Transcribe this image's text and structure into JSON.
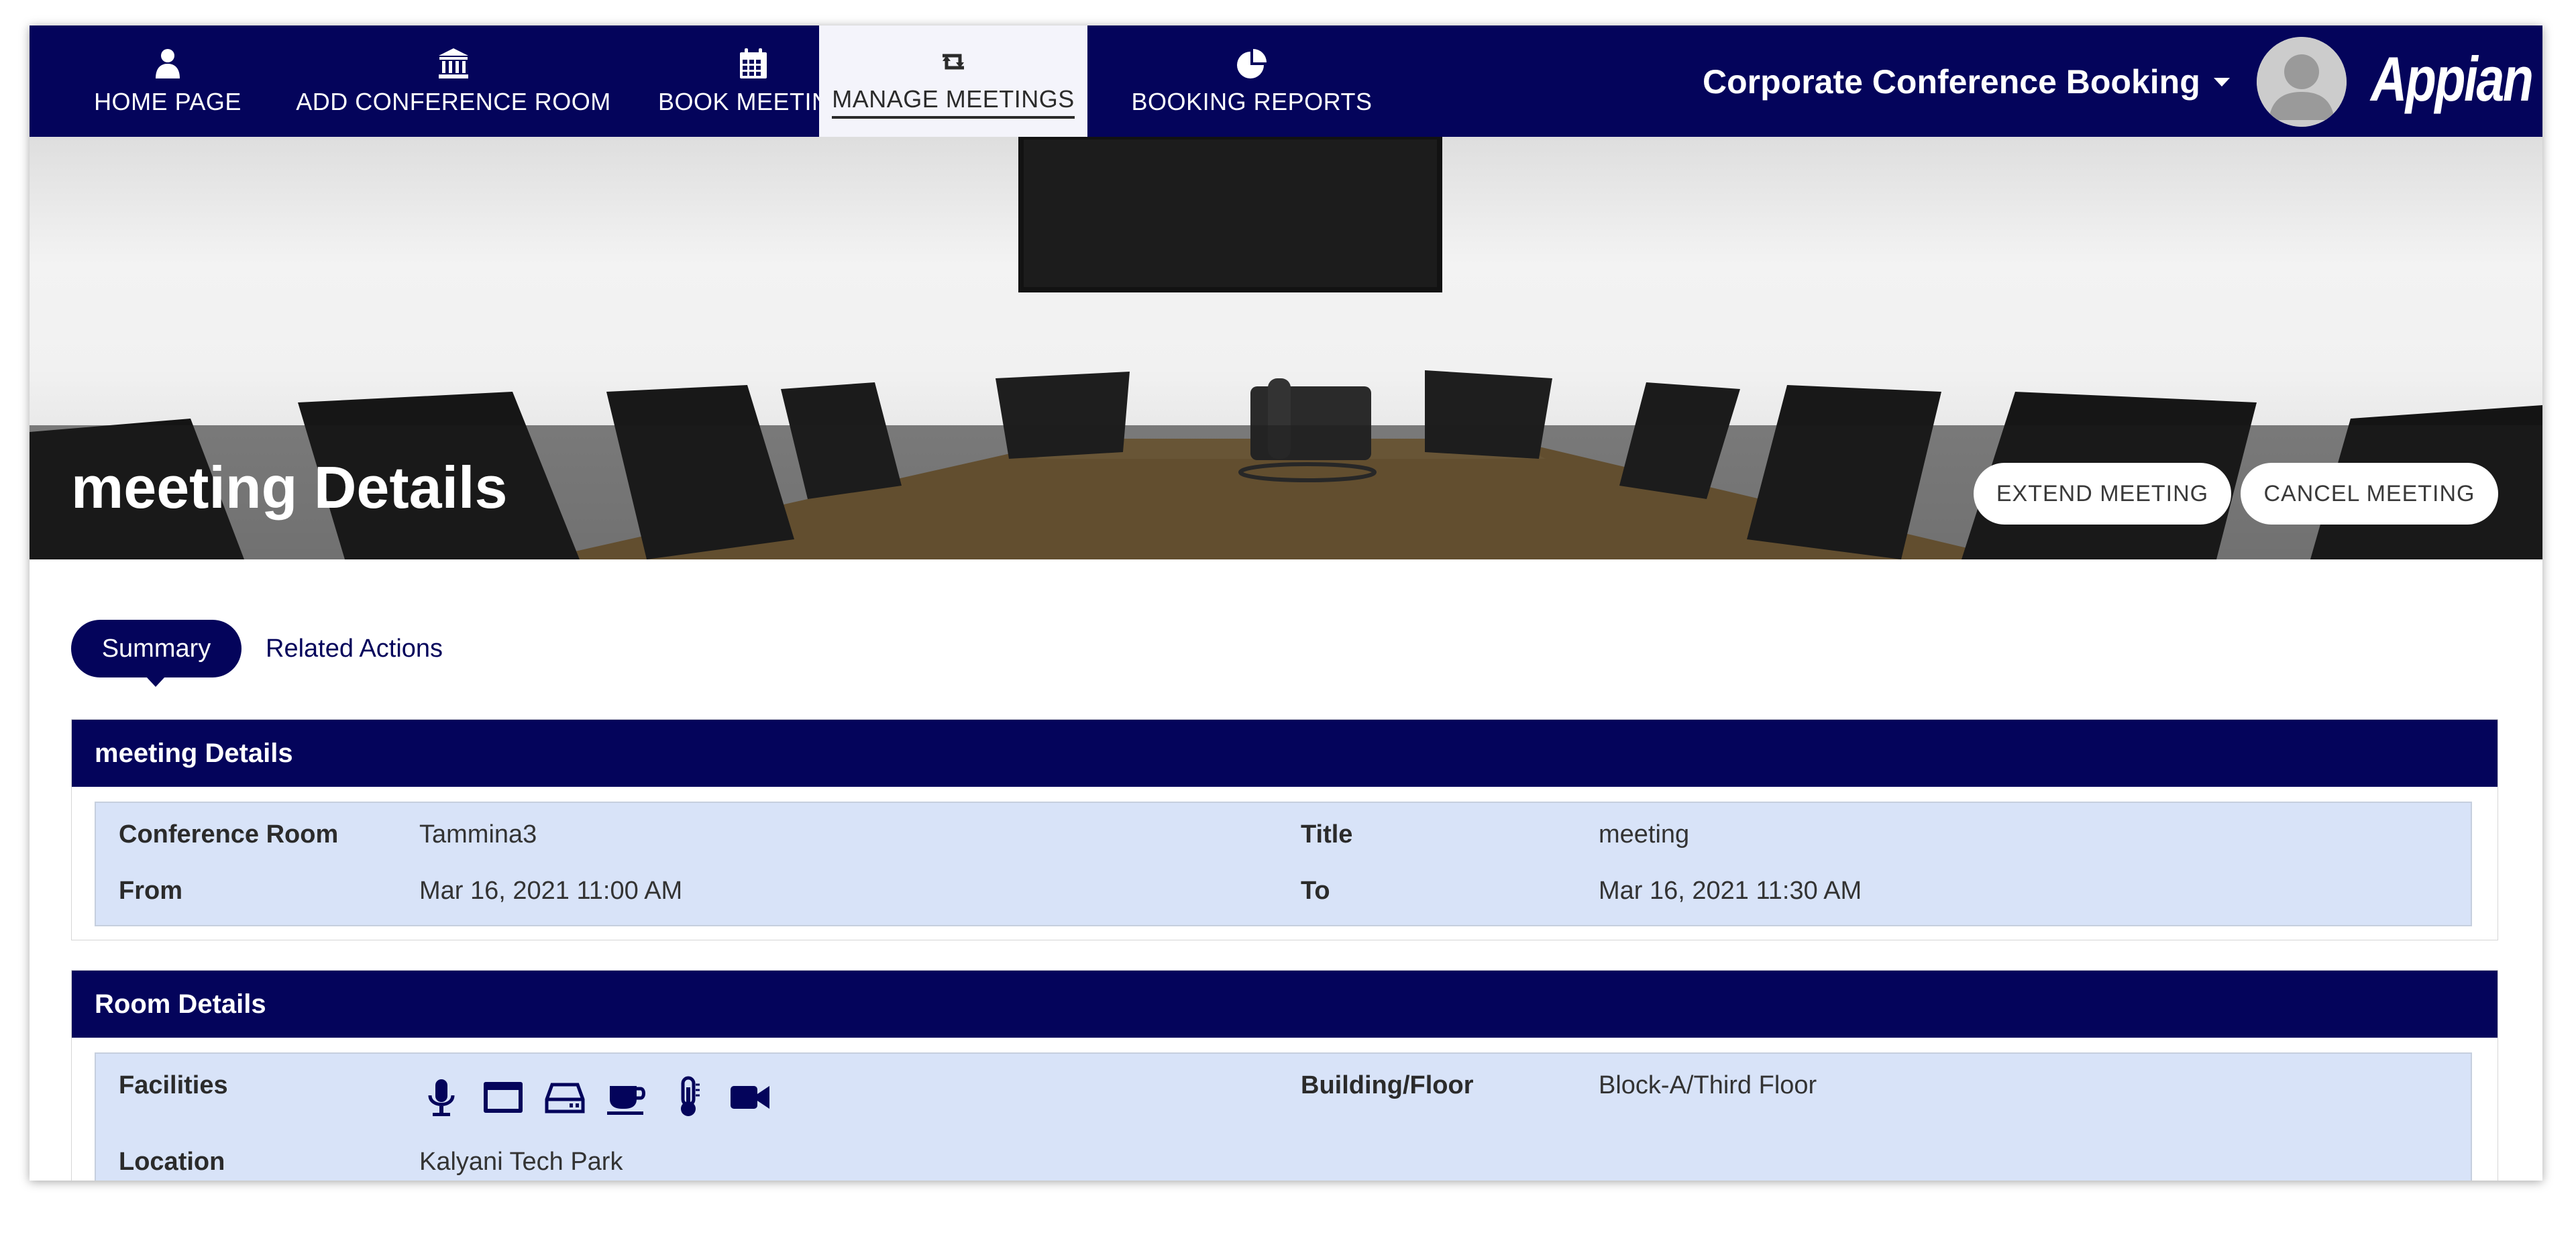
{
  "nav": {
    "items": [
      {
        "label": "HOME PAGE",
        "icon": "user-icon"
      },
      {
        "label": "ADD CONFERENCE ROOM",
        "icon": "bank-icon"
      },
      {
        "label": "BOOK MEETING",
        "icon": "calendar-icon"
      },
      {
        "label": "MANAGE MEETINGS",
        "icon": "retweet-icon",
        "active": true
      },
      {
        "label": "BOOKING REPORTS",
        "icon": "pie-chart-icon"
      }
    ],
    "app_title": "Corporate Conference Booking",
    "logo_text": "Appian"
  },
  "banner": {
    "title": "meeting Details",
    "buttons": {
      "extend": "EXTEND MEETING",
      "cancel": "CANCEL MEETING"
    }
  },
  "tabs": {
    "summary": "Summary",
    "related": "Related Actions"
  },
  "meeting_section": {
    "header": "meeting Details",
    "fields": {
      "room_label": "Conference Room",
      "room_value": "Tammina3",
      "title_label": "Title",
      "title_value": "meeting",
      "from_label": "From",
      "from_value": "Mar 16, 2021 11:00 AM",
      "to_label": "To",
      "to_value": "Mar 16, 2021 11:30 AM"
    }
  },
  "room_section": {
    "header": "Room Details",
    "fields": {
      "facilities_label": "Facilities",
      "facility_icons": [
        "microphone-icon",
        "projector-screen-icon",
        "hard-drive-icon",
        "coffee-cup-icon",
        "thermometer-icon",
        "video-camera-icon"
      ],
      "building_label": "Building/Floor",
      "building_value": "Block-A/Third Floor",
      "location_label": "Location",
      "location_value": "Kalyani Tech Park"
    }
  },
  "colors": {
    "navy": "#04045b",
    "field_bg": "#d8e3f8",
    "active_tab_bg": "#f4f4fb"
  }
}
